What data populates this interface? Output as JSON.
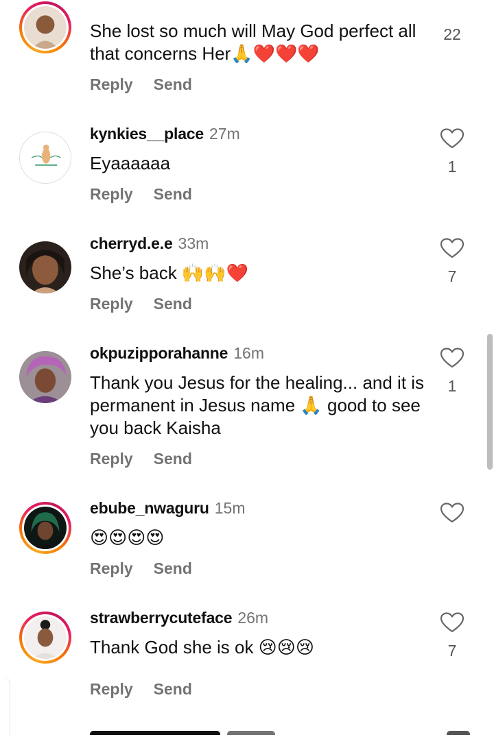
{
  "comments": [
    {
      "username": "",
      "time": "",
      "text": "She lost so much will May God perfect all that concerns Her🙏❤️❤️❤️",
      "reply_label": "Reply",
      "send_label": "Send",
      "likes": "22",
      "avatar": "avatar-woman-icon",
      "avatar_style": "story"
    },
    {
      "username": "kynkies__place",
      "time": "27m",
      "text": "Eyaaaaaa",
      "reply_label": "Reply",
      "send_label": "Send",
      "likes": "1",
      "avatar": "avatar-logo-icon",
      "avatar_style": "plain"
    },
    {
      "username": "cherryd.e.e",
      "time": "33m",
      "text": "She’s back 🙌🙌❤️",
      "reply_label": "Reply",
      "send_label": "Send",
      "likes": "7",
      "avatar": "avatar-woman-icon",
      "avatar_style": "none"
    },
    {
      "username": "okpuzipporahanne",
      "time": "16m",
      "text": "Thank you Jesus for the healing... and it is permanent in Jesus name 🙏 good to see you back Kaisha",
      "reply_label": "Reply",
      "send_label": "Send",
      "likes": "1",
      "avatar": "avatar-woman-headwrap-icon",
      "avatar_style": "none"
    },
    {
      "username": "ebube_nwaguru",
      "time": "15m",
      "text": "😍😍😍😍",
      "reply_label": "Reply",
      "send_label": "Send",
      "likes": "",
      "avatar": "avatar-woman-icon",
      "avatar_style": "story"
    },
    {
      "username": "strawberrycuteface",
      "time": "26m",
      "text": "Thank God she is ok 😢😢😢",
      "reply_label": "Reply",
      "send_label": "Send",
      "likes": "7",
      "avatar": "avatar-woman-icon",
      "avatar_style": "story"
    }
  ],
  "colors": {
    "username": "#111111",
    "secondary": "#737373",
    "story_ring_start": "#f9a825",
    "story_ring_end": "#e91e63"
  }
}
